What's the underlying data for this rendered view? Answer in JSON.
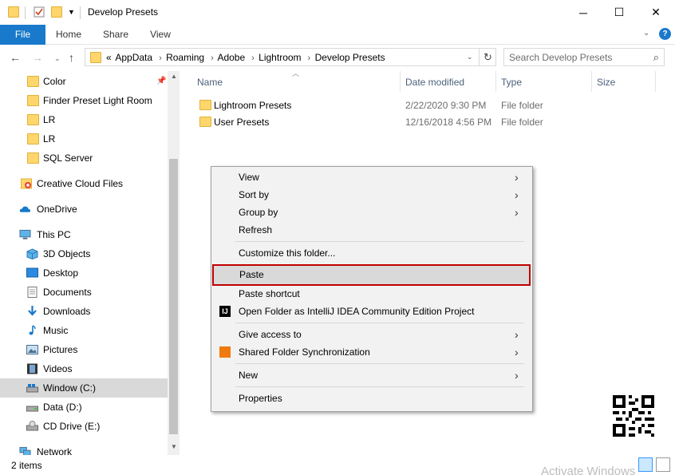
{
  "window": {
    "title": "Develop Presets"
  },
  "ribbon": {
    "tabs": [
      "File",
      "Home",
      "Share",
      "View"
    ]
  },
  "address": {
    "prefix": "«",
    "crumbs": [
      "AppData",
      "Roaming",
      "Adobe",
      "Lightroom",
      "Develop Presets"
    ]
  },
  "search": {
    "placeholder": "Search Develop Presets"
  },
  "sidebar": {
    "items": [
      {
        "label": "Color",
        "icon": "folder-icon"
      },
      {
        "label": "Finder Preset Light Room",
        "icon": "folder-icon"
      },
      {
        "label": "LR",
        "icon": "folder-icon"
      },
      {
        "label": "LR",
        "icon": "folder-icon"
      },
      {
        "label": "SQL Server",
        "icon": "folder-icon"
      },
      {
        "label": "Creative Cloud Files",
        "icon": "creative-cloud-icon"
      },
      {
        "label": "OneDrive",
        "icon": "onedrive-cloud-icon"
      },
      {
        "label": "This PC",
        "icon": "computer-icon"
      },
      {
        "label": "3D Objects",
        "icon": "cube-icon"
      },
      {
        "label": "Desktop",
        "icon": "desktop-icon"
      },
      {
        "label": "Documents",
        "icon": "document-icon"
      },
      {
        "label": "Downloads",
        "icon": "download-arrow-icon"
      },
      {
        "label": "Music",
        "icon": "music-note-icon"
      },
      {
        "label": "Pictures",
        "icon": "picture-icon"
      },
      {
        "label": "Videos",
        "icon": "film-icon"
      },
      {
        "label": "Window (C:)",
        "icon": "drive-icon"
      },
      {
        "label": "Data (D:)",
        "icon": "drive-icon"
      },
      {
        "label": "CD Drive (E:)",
        "icon": "cd-drive-icon"
      },
      {
        "label": "Network",
        "icon": "network-icon"
      }
    ]
  },
  "columns": {
    "name": "Name",
    "date": "Date modified",
    "type": "Type",
    "size": "Size"
  },
  "files": [
    {
      "name": "Lightroom Presets",
      "date": "2/22/2020 9:30 PM",
      "type": "File folder"
    },
    {
      "name": "User Presets",
      "date": "12/16/2018 4:56 PM",
      "type": "File folder"
    }
  ],
  "context_menu": {
    "items": [
      {
        "label": "View",
        "submenu": true
      },
      {
        "label": "Sort by",
        "submenu": true
      },
      {
        "label": "Group by",
        "submenu": true
      },
      {
        "label": "Refresh",
        "submenu": false
      },
      {
        "label": "Customize this folder...",
        "submenu": false
      },
      {
        "label": "Paste",
        "submenu": false,
        "highlighted": true
      },
      {
        "label": "Paste shortcut",
        "submenu": false
      },
      {
        "label": "Open Folder as IntelliJ IDEA Community Edition Project",
        "submenu": false,
        "icon": "intellij-icon"
      },
      {
        "label": "Give access to",
        "submenu": true
      },
      {
        "label": "Shared Folder Synchronization",
        "submenu": true,
        "icon": "sync-icon"
      },
      {
        "label": "New",
        "submenu": true
      },
      {
        "label": "Properties",
        "submenu": false
      }
    ],
    "highlight_color": "#c00000"
  },
  "status": {
    "count": "2 items"
  },
  "watermark": "Activate Windows",
  "colors": {
    "accent": "#1979ca",
    "folder": "#ffd66b",
    "column_header": "#4c607a"
  }
}
